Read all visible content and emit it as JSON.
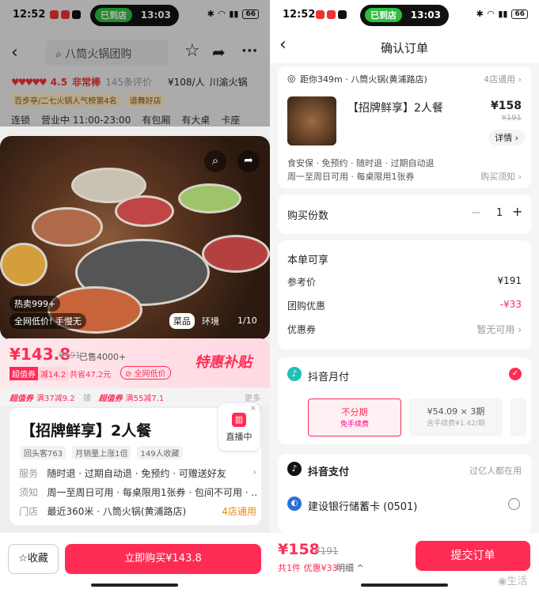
{
  "status_left": {
    "time": "12:52",
    "pill_label": "已到店",
    "pill_time": "13:03",
    "battery": "66"
  },
  "status_right": {
    "time": "12:52",
    "pill_label": "已到店",
    "pill_time": "13:03",
    "battery": "66"
  },
  "left": {
    "search": "八筒火锅团购",
    "rating": "4.5",
    "rating_label": "非常棒",
    "reviews": "145条评价",
    "per_person": "¥108/人",
    "cuisine": "川渝火锅",
    "rank_tag": "百步亭/二七火锅人气榜第4名",
    "tag2": "道舞好店",
    "info": [
      "连锁",
      "营业中 11:00-23:00",
      "有包厢",
      "有大桌",
      "卡座"
    ],
    "photo_badge": "热卖999+",
    "photo_low": "全网低价! 手慢无",
    "photo_tabs": [
      "菜品",
      "环境"
    ],
    "photo_page": "1/10",
    "price": "¥143.8",
    "original": "¥191",
    "sold": "已售4000+",
    "promo_tag": "超值券",
    "promo_amount": "减14.2",
    "save_text": "共省47.2元",
    "low_tag": "全网低价",
    "special": "特惠补贴",
    "coupon1": "超值券",
    "coupon1_text": "满37减9.2",
    "coupon_sep": "领",
    "coupon2": "超值券",
    "coupon2_text": "满55减7.1",
    "more": "更多",
    "title": "【招牌鲜享】2人餐",
    "chips": [
      "回头客763",
      "月销量上涨1倍",
      "149人收藏"
    ],
    "service_label": "服务",
    "service_text": "随时退 · 过期自动退 · 免预约 · 可赠送好友",
    "notice_label": "须知",
    "notice_text": "周一至周日可用 · 每桌限用1张券 · 包间不可用 · ...",
    "store_label": "门店",
    "store_text": "最近360米 · 八筒火锅(黄浦路店)",
    "store_count": "4店通用",
    "live": "直播中",
    "fav": "收藏",
    "buy": "立即购买¥143.8"
  },
  "right": {
    "title": "确认订单",
    "location": "距你349m · 八筒火锅(黄浦路店)",
    "stores": "4店通用",
    "product": "【招牌鲜享】2人餐",
    "price": "¥158",
    "original": "¥191",
    "detail": "详情",
    "guarantee": "食安保 · 免预约 · 随时退 · 过期自动退",
    "usage": "周一至周日可用 · 每桌限用1张券",
    "notice": "购买须知",
    "qty_label": "购买份数",
    "qty": "1",
    "section": "本单可享",
    "ref_label": "参考价",
    "ref_value": "¥191",
    "group_label": "团购优惠",
    "group_value": "-¥33",
    "coupon_label": "优惠券",
    "coupon_value": "暂无可用",
    "pay1": "抖音月付",
    "inst1_title": "不分期",
    "inst1_sub": "免手续费",
    "inst2_title": "¥54.09 × 3期",
    "inst2_sub": "含手续费¥1.42/期",
    "pay2": "抖音支付",
    "pay2_note": "过亿人都在用",
    "bank": "建设银行储蓄卡 (0501)",
    "total": "¥158",
    "total_orig": "¥191",
    "summary": "共1件 优惠¥33",
    "detail_link": "明细",
    "submit": "提交订单",
    "watermark": "生活"
  }
}
